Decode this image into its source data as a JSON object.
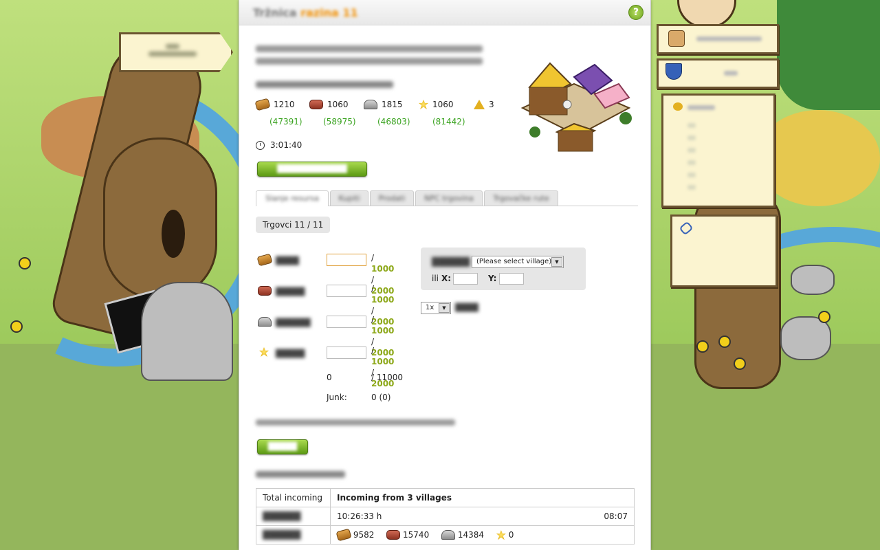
{
  "page": {
    "title_name": "Tržnica",
    "title_level": "razina 11",
    "help_label": "?"
  },
  "production": {
    "resources": [
      {
        "icon": "wood-icon",
        "amount": "1210",
        "total": "(47391)"
      },
      {
        "icon": "clay-icon",
        "amount": "1060",
        "total": "(58975)"
      },
      {
        "icon": "iron-icon",
        "amount": "1815",
        "total": "(46803)"
      },
      {
        "icon": "crop-icon",
        "amount": "1060",
        "total": "(81442)"
      },
      {
        "icon": "capacity-icon",
        "amount": "3"
      }
    ],
    "time": "3:01:40"
  },
  "tabs": [
    {
      "label": "Slanje resursa",
      "active": true
    },
    {
      "label": "Kupiti"
    },
    {
      "label": "Prodati"
    },
    {
      "label": "NPC trgovina"
    },
    {
      "label": "Trgovačke rute"
    }
  ],
  "merchants_label": "Trgovci 11 / 11",
  "send_form": {
    "rows": [
      {
        "icon": "wood-icon",
        "max1": "1000",
        "max2": "2000"
      },
      {
        "icon": "clay-icon",
        "max1": "1000",
        "max2": "2000"
      },
      {
        "icon": "iron-icon",
        "max1": "1000",
        "max2": "2000"
      },
      {
        "icon": "crop-icon",
        "max1": "1000",
        "max2": "2000"
      }
    ],
    "total_value": "0",
    "total_max": "/ 11000",
    "junk_label": "Junk:",
    "junk_value": "0 (0)",
    "village_select": "(Please select village)",
    "or_label": "ili",
    "x_label": "X:",
    "y_label": "Y:",
    "repeat_value": "1x"
  },
  "incoming": {
    "col1_header": "Total incoming",
    "col2_header": "Incoming from 3 villages",
    "arrival": "10:26:33 h",
    "arrival_time": "08:07",
    "resources": [
      {
        "icon": "wood-icon",
        "amount": "9582"
      },
      {
        "icon": "clay-icon",
        "amount": "15740"
      },
      {
        "icon": "iron-icon",
        "amount": "14384"
      },
      {
        "icon": "crop-icon",
        "amount": "0"
      }
    ]
  },
  "colors": {
    "accent_green": "#3aa320",
    "max_value": "#8da819",
    "title_level": "#f28f00"
  }
}
